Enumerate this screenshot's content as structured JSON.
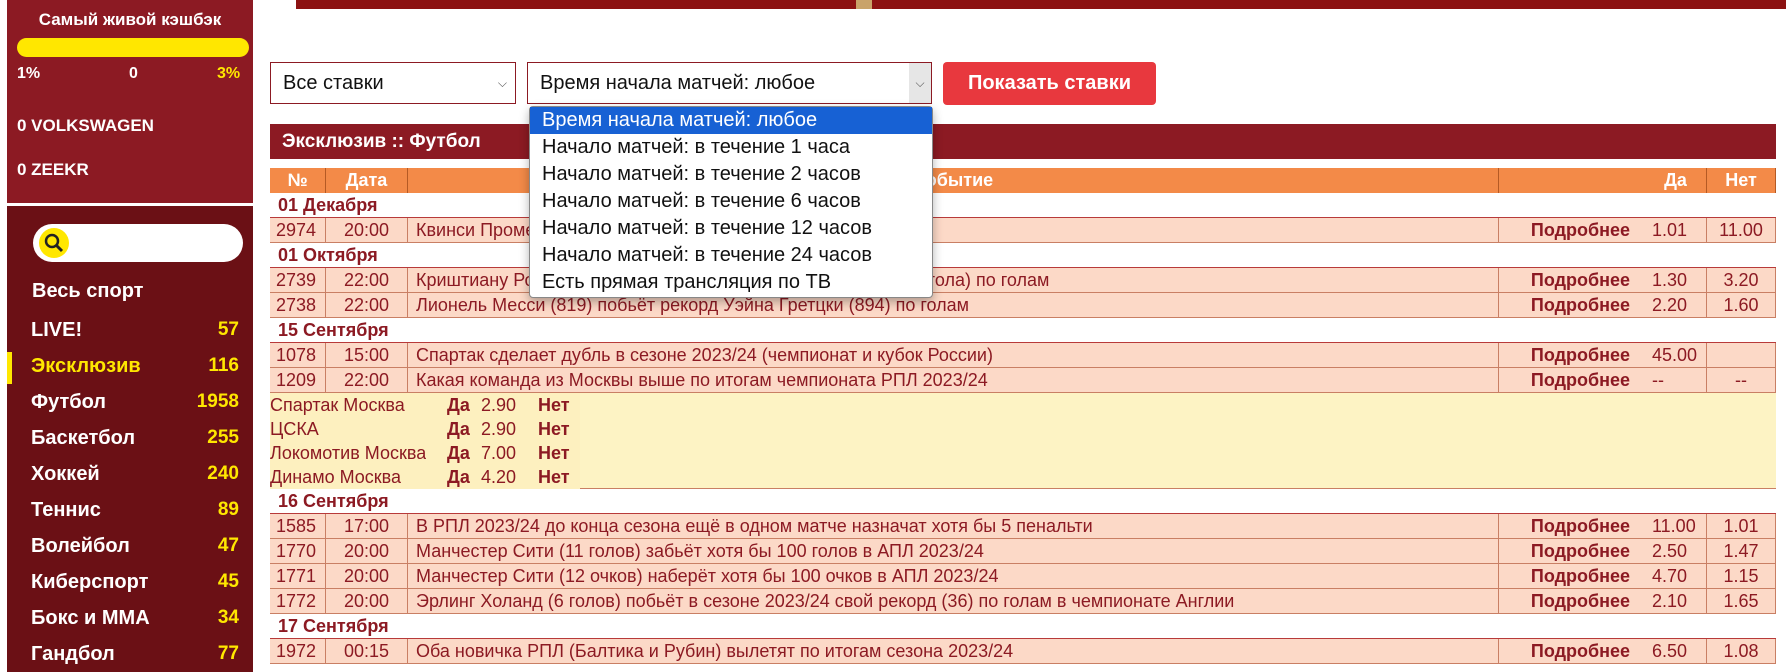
{
  "promo": {
    "title": "Самый живой кэшбэк",
    "progress": 0,
    "labels": [
      "1%",
      "0",
      "3%"
    ],
    "rows": [
      "0 VOLKSWAGEN",
      "0 ZEEKR"
    ],
    "accent": "#ffe700"
  },
  "sidebar": {
    "all_sport": "Весь спорт",
    "items": [
      {
        "name": "LIVE!",
        "count": "57"
      },
      {
        "name": "Эксклюзив",
        "count": "116"
      },
      {
        "name": "Футбол",
        "count": "1958"
      },
      {
        "name": "Баскетбол",
        "count": "255"
      },
      {
        "name": "Хоккей",
        "count": "240"
      },
      {
        "name": "Теннис",
        "count": "89"
      },
      {
        "name": "Волейбол",
        "count": "47"
      },
      {
        "name": "Киберспорт",
        "count": "45"
      },
      {
        "name": "Бокс и ММА",
        "count": "34"
      },
      {
        "name": "Гандбол",
        "count": "77"
      }
    ],
    "active_index": 1,
    "search_icon": "search-icon"
  },
  "filters": {
    "bets_value": "Все ставки",
    "time_value": "Время начала матчей: любое",
    "show_button": "Показать ставки"
  },
  "dropdown": {
    "options": [
      "Время начала матчей: любое",
      "Начало матчей: в течение 1 часа",
      "Начало матчей: в течение 2 часов",
      "Начало матчей: в течение 6 часов",
      "Начало матчей: в течение 12 часов",
      "Начало матчей: в течение 24 часов",
      "Есть прямая трансляция по ТВ"
    ],
    "selected_index": 0
  },
  "section": {
    "title": "Эксклюзив :: Футбол",
    "columns": {
      "num": "№",
      "date": "Дата",
      "event": "Событие",
      "yes": "Да",
      "no": "Нет"
    },
    "more_label": "Подробнее"
  },
  "table": [
    {
      "type": "date",
      "text": "01 Декабря"
    },
    {
      "type": "event",
      "num": "2974",
      "time": "20:00",
      "title": "Квинси Промес",
      "yes": "1.01",
      "no": "11.00"
    },
    {
      "type": "date",
      "text": "01 Октября"
    },
    {
      "type": "event",
      "num": "2739",
      "time": "22:00",
      "title": "Криштиану Роналду (873) побьёт рекорд Уэйна Гретцки (894 гола) по голам",
      "yes": "1.30",
      "no": "3.20"
    },
    {
      "type": "event",
      "num": "2738",
      "time": "22:00",
      "title": "Лионель Месси (819) побьёт рекорд Уэйна Гретцки (894) по голам",
      "yes": "2.20",
      "no": "1.60"
    },
    {
      "type": "date",
      "text": "15 Сентября"
    },
    {
      "type": "event",
      "num": "1078",
      "time": "15:00",
      "title": "Спартак сделает дубль в сезоне 2023/24 (чемпионат и кубок России)",
      "yes": "45.00",
      "no": ""
    },
    {
      "type": "event",
      "num": "1209",
      "time": "22:00",
      "title": "Какая команда из Москвы выше по итогам чемпионата РПЛ 2023/24",
      "yes": "--",
      "no": "--"
    },
    {
      "type": "sub",
      "items": [
        {
          "team": "Спартак Москва",
          "yes_label": "Да",
          "yes": "2.90",
          "no_label": "Нет"
        },
        {
          "team": "ЦСКА",
          "yes_label": "Да",
          "yes": "2.90",
          "no_label": "Нет"
        },
        {
          "team": "Локомотив Москва",
          "yes_label": "Да",
          "yes": "7.00",
          "no_label": "Нет"
        },
        {
          "team": "Динамо Москва",
          "yes_label": "Да",
          "yes": "4.20",
          "no_label": "Нет"
        }
      ]
    },
    {
      "type": "date",
      "text": "16 Сентября"
    },
    {
      "type": "event",
      "num": "1585",
      "time": "17:00",
      "title": "В РПЛ 2023/24 до конца сезона ещё в одном матче назначат хотя бы 5 пенальти",
      "yes": "11.00",
      "no": "1.01"
    },
    {
      "type": "event",
      "num": "1770",
      "time": "20:00",
      "title": "Манчестер Сити (11 голов) забьёт хотя бы 100 голов в АПЛ 2023/24",
      "yes": "2.50",
      "no": "1.47"
    },
    {
      "type": "event",
      "num": "1771",
      "time": "20:00",
      "title": "Манчестер Сити (12 очков) наберёт хотя бы 100 очков в АПЛ 2023/24",
      "yes": "4.70",
      "no": "1.15"
    },
    {
      "type": "event",
      "num": "1772",
      "time": "20:00",
      "title": "Эрлинг Холанд (6 голов) побьёт в сезоне 2023/24 свой рекорд (36) по голам в чемпионате Англии",
      "yes": "2.10",
      "no": "1.65"
    },
    {
      "type": "date",
      "text": "17 Сентября"
    },
    {
      "type": "event",
      "num": "1972",
      "time": "00:15",
      "title": "Оба новичка РПЛ (Балтика и Рубин) вылетят по итогам сезона 2023/24",
      "yes": "6.50",
      "no": "1.08"
    }
  ]
}
